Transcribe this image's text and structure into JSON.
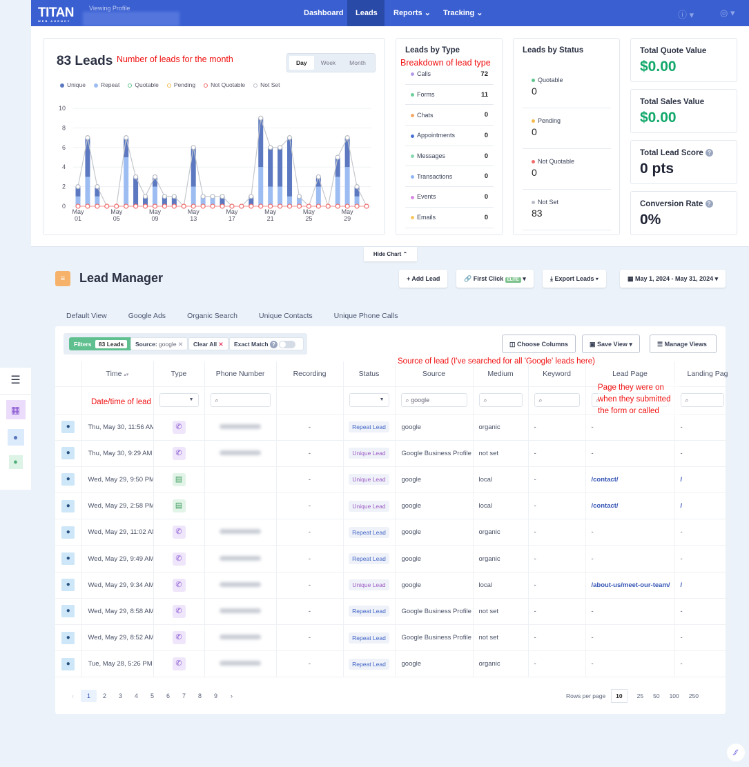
{
  "nav": {
    "logo": "TITAN",
    "logo_sub": "WEB AGENCY",
    "viewing_label": "Viewing Profile",
    "items": [
      {
        "label": "Dashboard"
      },
      {
        "label": "Leads",
        "active": true
      },
      {
        "label": "Reports ⌄"
      },
      {
        "label": "Tracking ⌄"
      }
    ],
    "help_icon": "help-circle-icon",
    "user_icon": "user-circle-icon",
    "accent": "#3a5fd1"
  },
  "summary": {
    "title": "83 Leads",
    "annotation": "Number of leads for the month",
    "ranges": [
      "Day",
      "Week",
      "Month"
    ],
    "selected_range": "Day",
    "legend": [
      {
        "label": "Unique",
        "color": "#5b78c0",
        "style": "dot"
      },
      {
        "label": "Repeat",
        "color": "#9dbdf2",
        "style": "dot"
      },
      {
        "label": "Quotable",
        "color": "#5fc48c",
        "style": "ring"
      },
      {
        "label": "Pending",
        "color": "#f5b94c",
        "style": "ring"
      },
      {
        "label": "Not Quotable",
        "color": "#f26b6b",
        "style": "ring"
      },
      {
        "label": "Not Set",
        "color": "#b8bcc4",
        "style": "ring"
      }
    ]
  },
  "chart_data": {
    "type": "bar",
    "stacked": true,
    "ylim": [
      0,
      10
    ],
    "yticks": [
      "0",
      "2",
      "4",
      "6",
      "8",
      "10"
    ],
    "x": [
      1,
      2,
      3,
      4,
      5,
      6,
      7,
      8,
      9,
      10,
      11,
      12,
      13,
      14,
      15,
      16,
      17,
      18,
      19,
      20,
      21,
      22,
      23,
      24,
      25,
      26,
      27,
      28,
      29,
      30,
      31
    ],
    "xtick_labels": [
      {
        "day": 1,
        "l1": "May",
        "l2": "01"
      },
      {
        "day": 5,
        "l1": "May",
        "l2": "05"
      },
      {
        "day": 9,
        "l1": "May",
        "l2": "09"
      },
      {
        "day": 13,
        "l1": "May",
        "l2": "13"
      },
      {
        "day": 17,
        "l1": "May",
        "l2": "17"
      },
      {
        "day": 21,
        "l1": "May",
        "l2": "21"
      },
      {
        "day": 25,
        "l1": "May",
        "l2": "25"
      },
      {
        "day": 29,
        "l1": "May",
        "l2": "29"
      }
    ],
    "series": [
      {
        "name": "Repeat",
        "values": [
          1,
          3,
          1,
          0,
          0,
          5,
          0,
          0,
          2,
          0,
          0,
          0,
          2,
          1,
          1,
          0,
          0,
          0,
          0,
          4,
          2,
          2,
          1,
          1,
          0,
          2,
          0,
          3,
          4,
          1,
          0
        ]
      },
      {
        "name": "Unique",
        "values": [
          1,
          4,
          1,
          0,
          0,
          2,
          3,
          1,
          1,
          1,
          1,
          0,
          4,
          0,
          0,
          1,
          0,
          0,
          1,
          5,
          4,
          4,
          6,
          0,
          0,
          1,
          0,
          2,
          3,
          1,
          0
        ]
      },
      {
        "name": "Not Set",
        "type": "line",
        "values": [
          2,
          7,
          2,
          0,
          0,
          7,
          3,
          1,
          3,
          1,
          1,
          0,
          6,
          1,
          1,
          1,
          0,
          0,
          1,
          9,
          6,
          6,
          7,
          1,
          0,
          3,
          0,
          5,
          7,
          2,
          0
        ]
      },
      {
        "name": "Not Quotable",
        "type": "line",
        "values": [
          0,
          0,
          0,
          0,
          0,
          0,
          0,
          0,
          0,
          0,
          0,
          0,
          0,
          0,
          0,
          0,
          0,
          0,
          0,
          0,
          0,
          0,
          0,
          0,
          0,
          0,
          0,
          0,
          0,
          0,
          0
        ]
      }
    ]
  },
  "by_type": {
    "title": "Leads by Type",
    "annotation": "Breakdown of lead type",
    "rows": [
      {
        "label": "Calls",
        "value": "72",
        "color": "#b49be8"
      },
      {
        "label": "Forms",
        "value": "11",
        "color": "#6ccf9b"
      },
      {
        "label": "Chats",
        "value": "0",
        "color": "#f6a860"
      },
      {
        "label": "Appointments",
        "value": "0",
        "color": "#4a6fd6"
      },
      {
        "label": "Messages",
        "value": "0",
        "color": "#86d7b0"
      },
      {
        "label": "Transactions",
        "value": "0",
        "color": "#8fb4f4"
      },
      {
        "label": "Events",
        "value": "0",
        "color": "#d68be0"
      },
      {
        "label": "Emails",
        "value": "0",
        "color": "#f7c85e"
      }
    ]
  },
  "by_status": {
    "title": "Leads by Status",
    "rows": [
      {
        "label": "Quotable",
        "value": "0",
        "color": "#5fc48c"
      },
      {
        "label": "Pending",
        "value": "0",
        "color": "#f5b94c"
      },
      {
        "label": "Not Quotable",
        "value": "0",
        "color": "#f26b6b"
      },
      {
        "label": "Not Set",
        "value": "83",
        "color": "#b8bcc4"
      }
    ]
  },
  "kpis": [
    {
      "label": "Total Quote Value",
      "value": "$0.00",
      "green": true
    },
    {
      "label": "Total Sales Value",
      "value": "$0.00",
      "green": true
    },
    {
      "label": "Total Lead Score",
      "value": "0 pts",
      "help": true
    },
    {
      "label": "Conversion Rate",
      "value": "0%",
      "help": true
    }
  ],
  "hide_chart": "Hide Chart ⌃",
  "manager": {
    "title": "Lead Manager",
    "buttons": {
      "add": "+  Add Lead",
      "first_click": "First Click",
      "elite": "ELITE",
      "export": "Export Leads",
      "date_range": "May 1, 2024 - May 31, 2024"
    },
    "tabs": [
      "Default View",
      "Google Ads",
      "Organic Search",
      "Unique Contacts",
      "Unique Phone Calls"
    ],
    "filters": {
      "label": "Filters",
      "count": "83 Leads",
      "source_label": "Source:",
      "source_value": "google",
      "clear_all": "Clear All",
      "exact_match": "Exact Match",
      "exact_match_on": false
    },
    "actions": {
      "choose_columns": "Choose Columns",
      "save_view": "Save View",
      "manage_views": "Manage Views"
    },
    "annotations": {
      "source": "Source of lead (I've searched for all 'Google' leads here)",
      "time": "Date/time of lead",
      "lead_page": "Page they were on when they submitted the form or called"
    },
    "columns": [
      "Time",
      "Type",
      "Phone Number",
      "Recording",
      "Status",
      "Source",
      "Medium",
      "Keyword",
      "Lead Page",
      "Landing Pag"
    ],
    "source_search": "google",
    "rows": [
      {
        "time": "Thu, May 30, 11:56 AM",
        "type": "call",
        "recording": "-",
        "status": "Repeat Lead",
        "source": "google",
        "medium": "organic",
        "keyword": "-",
        "lead_page": "-",
        "landing": "-"
      },
      {
        "time": "Thu, May 30, 9:29 AM",
        "type": "call",
        "recording": "-",
        "status": "Unique Lead",
        "source": "Google Business Profile",
        "medium": "not set",
        "keyword": "-",
        "lead_page": "-",
        "landing": "-"
      },
      {
        "time": "Wed, May 29, 9:50 PM",
        "type": "form",
        "recording": "-",
        "status": "Unique Lead",
        "source": "google",
        "medium": "local",
        "keyword": "-",
        "lead_page": "/contact/",
        "landing": "/"
      },
      {
        "time": "Wed, May 29, 2:58 PM",
        "type": "form",
        "recording": "-",
        "status": "Unique Lead",
        "source": "google",
        "medium": "local",
        "keyword": "-",
        "lead_page": "/contact/",
        "landing": "/"
      },
      {
        "time": "Wed, May 29, 11:02 AM",
        "type": "call",
        "recording": "-",
        "status": "Repeat Lead",
        "source": "google",
        "medium": "organic",
        "keyword": "-",
        "lead_page": "-",
        "landing": "-"
      },
      {
        "time": "Wed, May 29, 9:49 AM",
        "type": "call",
        "recording": "-",
        "status": "Repeat Lead",
        "source": "google",
        "medium": "organic",
        "keyword": "-",
        "lead_page": "-",
        "landing": "-"
      },
      {
        "time": "Wed, May 29, 9:34 AM",
        "type": "call",
        "recording": "-",
        "status": "Unique Lead",
        "source": "google",
        "medium": "local",
        "keyword": "-",
        "lead_page": "/about-us/meet-our-team/",
        "landing": "/"
      },
      {
        "time": "Wed, May 29, 8:58 AM",
        "type": "call",
        "recording": "-",
        "status": "Repeat Lead",
        "source": "Google Business Profile",
        "medium": "not set",
        "keyword": "-",
        "lead_page": "-",
        "landing": "-"
      },
      {
        "time": "Wed, May 29, 8:52 AM",
        "type": "call",
        "recording": "-",
        "status": "Repeat Lead",
        "source": "Google Business Profile",
        "medium": "not set",
        "keyword": "-",
        "lead_page": "-",
        "landing": "-"
      },
      {
        "time": "Tue, May 28, 5:26 PM",
        "type": "call",
        "recording": "-",
        "status": "Repeat Lead",
        "source": "google",
        "medium": "organic",
        "keyword": "-",
        "lead_page": "-",
        "landing": "-"
      }
    ],
    "pagination": {
      "pages": [
        "1",
        "2",
        "3",
        "4",
        "5",
        "6",
        "7",
        "8",
        "9"
      ],
      "current": "1",
      "prev": "‹",
      "next": "›",
      "rows_label": "Rows per page",
      "rows_options": [
        "10",
        "25",
        "50",
        "100",
        "250"
      ],
      "rows_selected": "10"
    }
  }
}
